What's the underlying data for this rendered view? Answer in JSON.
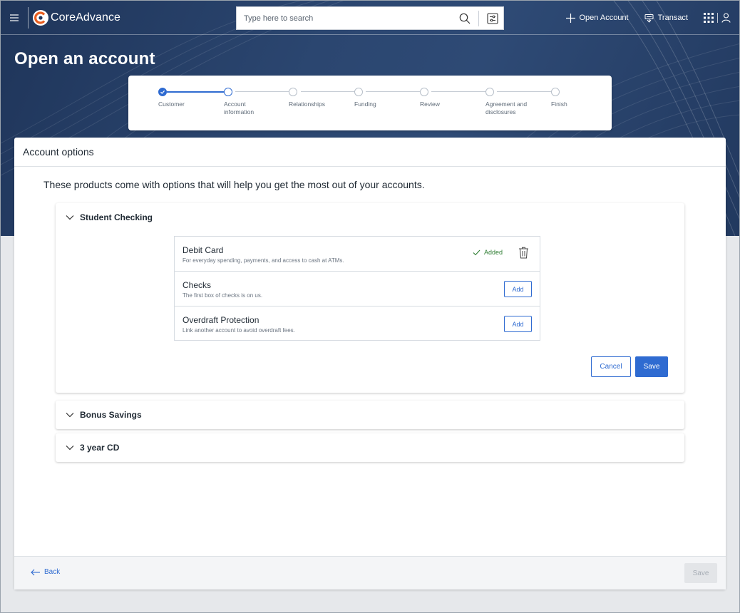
{
  "app": {
    "name": "CoreAdvance"
  },
  "search": {
    "placeholder": "Type here to search"
  },
  "topbar": {
    "open_account_label": "Open Account",
    "transact_label": "Transact"
  },
  "page": {
    "title": "Open an account"
  },
  "stepper": {
    "steps": [
      {
        "label": "Customer",
        "state": "done"
      },
      {
        "label": "Account information",
        "state": "current"
      },
      {
        "label": "Relationships",
        "state": "pending"
      },
      {
        "label": "Funding",
        "state": "pending"
      },
      {
        "label": "Review",
        "state": "pending"
      },
      {
        "label": "Agreement and disclosures",
        "state": "pending"
      },
      {
        "label": "Finish",
        "state": "pending"
      }
    ]
  },
  "panel": {
    "title": "Account options",
    "intro": "These products come with options that will help you get the most out of your accounts."
  },
  "products": [
    {
      "name": "Student Checking",
      "expanded": true,
      "options": [
        {
          "name": "Debit Card",
          "desc": "For everyday spending, payments, and access to cash at ATMs.",
          "status": "Added"
        },
        {
          "name": "Checks",
          "desc": "The first box of checks is on us.",
          "action": "Add"
        },
        {
          "name": "Overdraft Protection",
          "desc": "Link another account to avoid overdraft fees.",
          "action": "Add"
        }
      ],
      "cancel_label": "Cancel",
      "save_label": "Save"
    },
    {
      "name": "Bonus Savings",
      "expanded": false
    },
    {
      "name": "3 year CD",
      "expanded": false
    }
  ],
  "footer": {
    "back_label": "Back",
    "save_label": "Save"
  },
  "colors": {
    "accent": "#2f6bd1",
    "header_bg": "#2a4168",
    "success": "#2e7d32"
  }
}
